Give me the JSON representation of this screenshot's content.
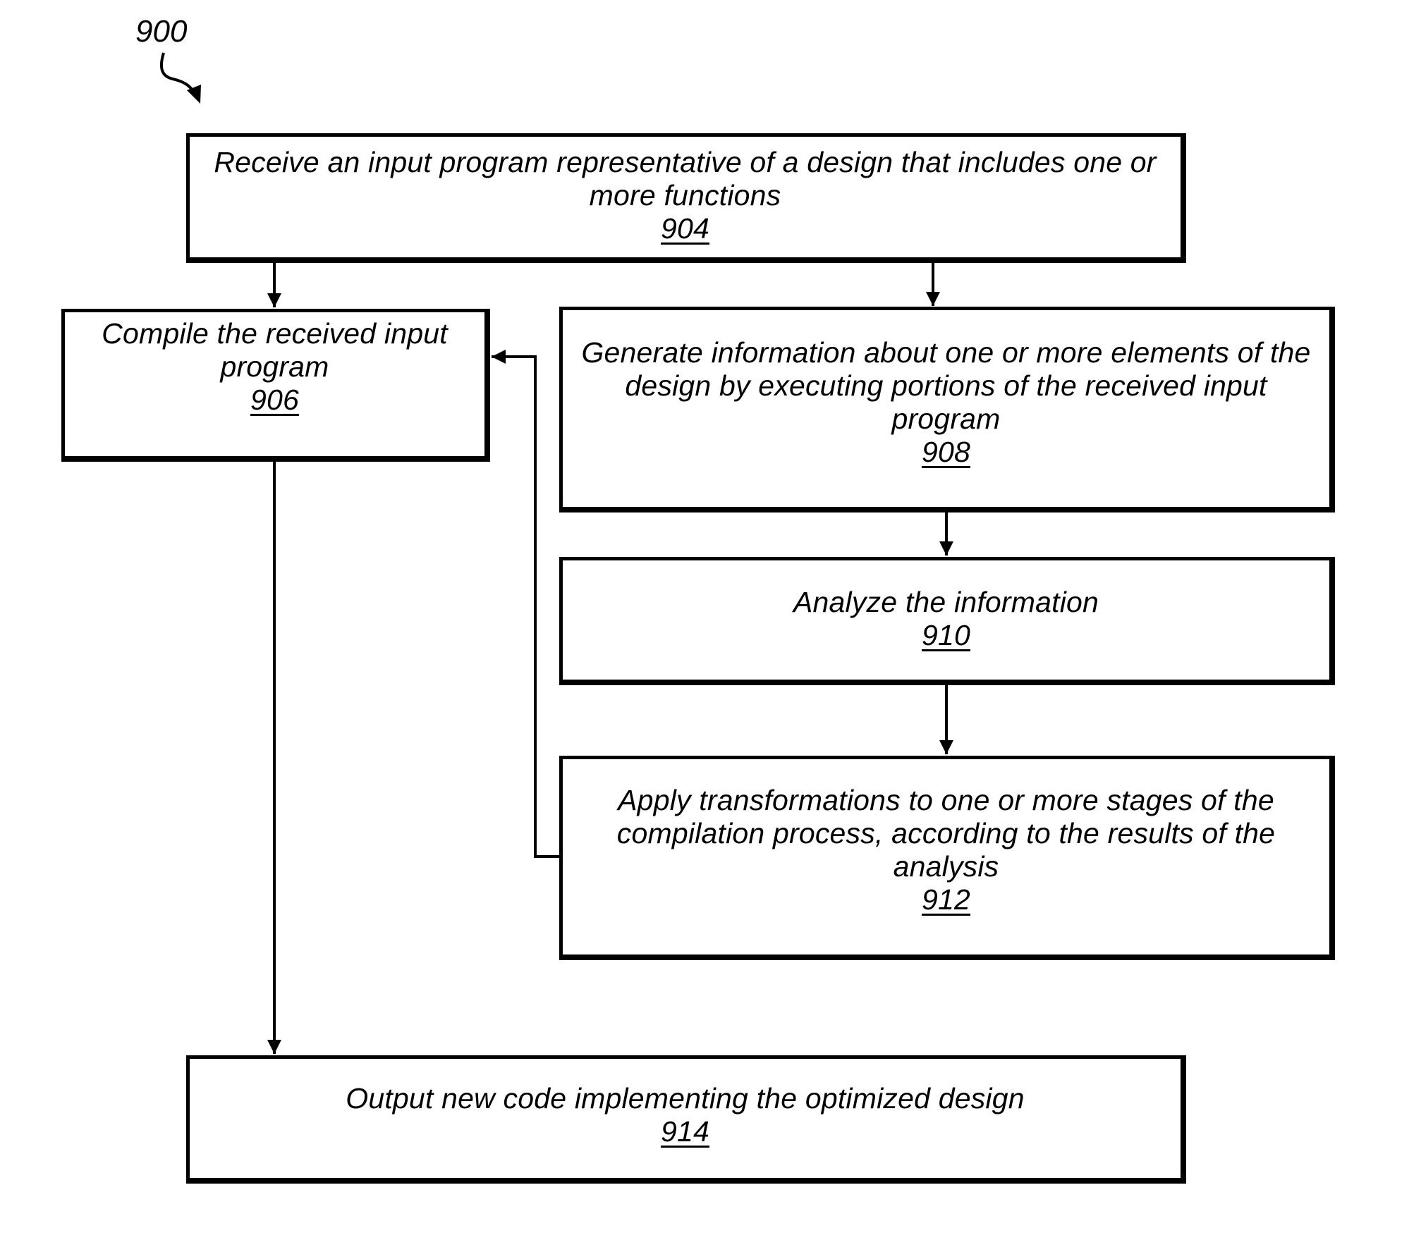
{
  "figure": {
    "label": "900",
    "steps": [
      {
        "id": "904",
        "text": "Receive an input program representative of a design that includes one or more functions",
        "ref": "904"
      },
      {
        "id": "906",
        "text": "Compile the received input program",
        "ref": "906"
      },
      {
        "id": "908",
        "text": "Generate information about one or more elements of the design by executing portions of the received input program",
        "ref": "908"
      },
      {
        "id": "910",
        "text": "Analyze the information",
        "ref": "910"
      },
      {
        "id": "912",
        "text": "Apply transformations to one or more stages of the compilation process, according to the results of the analysis",
        "ref": "912"
      },
      {
        "id": "914",
        "text": "Output new code implementing the optimized design",
        "ref": "914"
      }
    ],
    "edges": [
      {
        "from": "904",
        "to": "906"
      },
      {
        "from": "904",
        "to": "908"
      },
      {
        "from": "908",
        "to": "910"
      },
      {
        "from": "910",
        "to": "912"
      },
      {
        "from": "912",
        "to": "906"
      },
      {
        "from": "906",
        "to": "914"
      }
    ]
  }
}
